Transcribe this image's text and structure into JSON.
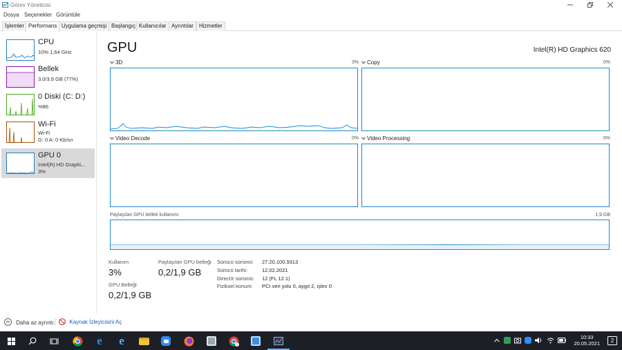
{
  "window": {
    "title": "Görev Yöneticisi"
  },
  "menu": [
    "Dosya",
    "Seçenekler",
    "Görüntüle"
  ],
  "tabs": [
    "İşlemler",
    "Performans",
    "Uygulama geçmişi",
    "Başlangıç",
    "Kullanıcılar",
    "Ayrıntılar",
    "Hizmetler"
  ],
  "active_tab": "Performans",
  "sidebar": [
    {
      "name": "CPU",
      "line1": "10%  1,64 GHz",
      "line2": "",
      "color": "#1a7fc4"
    },
    {
      "name": "Bellek",
      "line1": "3,0/3,9 GB (77%)",
      "line2": "",
      "color": "#8b12ae"
    },
    {
      "name": "0 Diski (C: D:)",
      "line1": "%86",
      "line2": "",
      "color": "#4da81e"
    },
    {
      "name": "Wi-Fi",
      "line1": "Wi-Fi",
      "line2": "G: 0  A: 0 Kb/sn",
      "color": "#a74f01"
    },
    {
      "name": "GPU 0",
      "line1": "Intel(R) HD Graphi...",
      "line2": "3%",
      "color": "#1a7fc4"
    }
  ],
  "main": {
    "title": "GPU",
    "device": "Intel(R) HD Graphics 620",
    "graphs": [
      {
        "label": "3D",
        "pct": "3%"
      },
      {
        "label": "Copy",
        "pct": "0%"
      },
      {
        "label": "Video Decode",
        "pct": "0%"
      },
      {
        "label": "Video Processing",
        "pct": "0%"
      }
    ],
    "shared_mem_label": "Paylaşılan GPU bellek kullanımı",
    "shared_mem_max": "1,9 GB",
    "stats": {
      "usage_label": "Kullanım",
      "usage_value": "3%",
      "shared_label": "Paylaşılan GPU belleği",
      "shared_value": "0,2/1,9 GB",
      "gpu_mem_label": "GPU Belleği",
      "gpu_mem_value": "0,2/1,9 GB"
    },
    "info": [
      {
        "key": "Sürücü sürümü:",
        "value": "27.20.100.9313"
      },
      {
        "key": "Sürücü tarihi:",
        "value": "12.02.2021"
      },
      {
        "key": "DirectX sürümü:",
        "value": "12 (FL 12.1)"
      },
      {
        "key": "Fiziksel konum:",
        "value": "PCI veri yolu 0, aygıt 2, işlev 0"
      }
    ]
  },
  "footer": {
    "fewer_details": "Daha az ayrıntı",
    "resource_monitor": "Kaynak İzleyicisini Aç"
  },
  "taskbar": {
    "time": "10:33",
    "date": "20.05.2021",
    "notifications": "2"
  }
}
